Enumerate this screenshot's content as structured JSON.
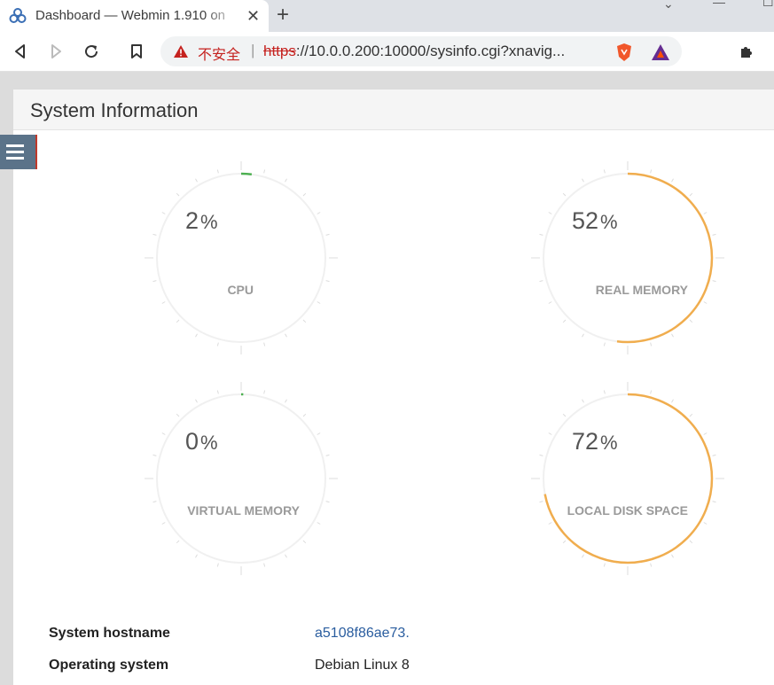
{
  "browser": {
    "tab_title": "Dashboard — Webmin 1.910 on",
    "new_tab_icon": "plus-icon",
    "insecure_label": "不安全",
    "url_scheme": "https",
    "url_rest": "://10.0.0.200:10000/sysinfo.cgi?xnavig..."
  },
  "page": {
    "title": "System Information"
  },
  "gauges": [
    {
      "value": "2",
      "percent": 2,
      "unit": "%",
      "label": "CPU",
      "color": "#4caf50"
    },
    {
      "value": "52",
      "percent": 52,
      "unit": "%",
      "label": "REAL MEMORY",
      "color": "#f0ad4e"
    },
    {
      "value": "0",
      "percent": 0,
      "unit": "%",
      "label": "VIRTUAL MEMORY",
      "color": "#4caf50"
    },
    {
      "value": "72",
      "percent": 72,
      "unit": "%",
      "label": "LOCAL DISK SPACE",
      "color": "#f0ad4e"
    }
  ],
  "info": {
    "hostname_label": "System hostname",
    "hostname_value": "a5108f86ae73.",
    "os_label": "Operating system",
    "os_value": "Debian Linux 8"
  }
}
